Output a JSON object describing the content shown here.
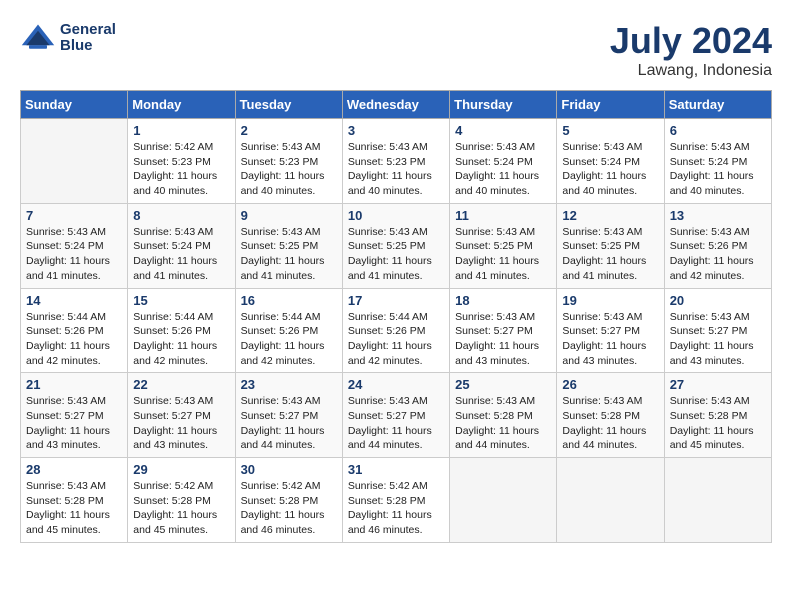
{
  "header": {
    "logo_line1": "General",
    "logo_line2": "Blue",
    "month_year": "July 2024",
    "location": "Lawang, Indonesia"
  },
  "days_of_week": [
    "Sunday",
    "Monday",
    "Tuesday",
    "Wednesday",
    "Thursday",
    "Friday",
    "Saturday"
  ],
  "weeks": [
    [
      {
        "day": "",
        "info": ""
      },
      {
        "day": "1",
        "info": "Sunrise: 5:42 AM\nSunset: 5:23 PM\nDaylight: 11 hours\nand 40 minutes."
      },
      {
        "day": "2",
        "info": "Sunrise: 5:43 AM\nSunset: 5:23 PM\nDaylight: 11 hours\nand 40 minutes."
      },
      {
        "day": "3",
        "info": "Sunrise: 5:43 AM\nSunset: 5:23 PM\nDaylight: 11 hours\nand 40 minutes."
      },
      {
        "day": "4",
        "info": "Sunrise: 5:43 AM\nSunset: 5:24 PM\nDaylight: 11 hours\nand 40 minutes."
      },
      {
        "day": "5",
        "info": "Sunrise: 5:43 AM\nSunset: 5:24 PM\nDaylight: 11 hours\nand 40 minutes."
      },
      {
        "day": "6",
        "info": "Sunrise: 5:43 AM\nSunset: 5:24 PM\nDaylight: 11 hours\nand 40 minutes."
      }
    ],
    [
      {
        "day": "7",
        "info": "Sunrise: 5:43 AM\nSunset: 5:24 PM\nDaylight: 11 hours\nand 41 minutes."
      },
      {
        "day": "8",
        "info": "Sunrise: 5:43 AM\nSunset: 5:24 PM\nDaylight: 11 hours\nand 41 minutes."
      },
      {
        "day": "9",
        "info": "Sunrise: 5:43 AM\nSunset: 5:25 PM\nDaylight: 11 hours\nand 41 minutes."
      },
      {
        "day": "10",
        "info": "Sunrise: 5:43 AM\nSunset: 5:25 PM\nDaylight: 11 hours\nand 41 minutes."
      },
      {
        "day": "11",
        "info": "Sunrise: 5:43 AM\nSunset: 5:25 PM\nDaylight: 11 hours\nand 41 minutes."
      },
      {
        "day": "12",
        "info": "Sunrise: 5:43 AM\nSunset: 5:25 PM\nDaylight: 11 hours\nand 41 minutes."
      },
      {
        "day": "13",
        "info": "Sunrise: 5:43 AM\nSunset: 5:26 PM\nDaylight: 11 hours\nand 42 minutes."
      }
    ],
    [
      {
        "day": "14",
        "info": "Sunrise: 5:44 AM\nSunset: 5:26 PM\nDaylight: 11 hours\nand 42 minutes."
      },
      {
        "day": "15",
        "info": "Sunrise: 5:44 AM\nSunset: 5:26 PM\nDaylight: 11 hours\nand 42 minutes."
      },
      {
        "day": "16",
        "info": "Sunrise: 5:44 AM\nSunset: 5:26 PM\nDaylight: 11 hours\nand 42 minutes."
      },
      {
        "day": "17",
        "info": "Sunrise: 5:44 AM\nSunset: 5:26 PM\nDaylight: 11 hours\nand 42 minutes."
      },
      {
        "day": "18",
        "info": "Sunrise: 5:43 AM\nSunset: 5:27 PM\nDaylight: 11 hours\nand 43 minutes."
      },
      {
        "day": "19",
        "info": "Sunrise: 5:43 AM\nSunset: 5:27 PM\nDaylight: 11 hours\nand 43 minutes."
      },
      {
        "day": "20",
        "info": "Sunrise: 5:43 AM\nSunset: 5:27 PM\nDaylight: 11 hours\nand 43 minutes."
      }
    ],
    [
      {
        "day": "21",
        "info": "Sunrise: 5:43 AM\nSunset: 5:27 PM\nDaylight: 11 hours\nand 43 minutes."
      },
      {
        "day": "22",
        "info": "Sunrise: 5:43 AM\nSunset: 5:27 PM\nDaylight: 11 hours\nand 43 minutes."
      },
      {
        "day": "23",
        "info": "Sunrise: 5:43 AM\nSunset: 5:27 PM\nDaylight: 11 hours\nand 44 minutes."
      },
      {
        "day": "24",
        "info": "Sunrise: 5:43 AM\nSunset: 5:27 PM\nDaylight: 11 hours\nand 44 minutes."
      },
      {
        "day": "25",
        "info": "Sunrise: 5:43 AM\nSunset: 5:28 PM\nDaylight: 11 hours\nand 44 minutes."
      },
      {
        "day": "26",
        "info": "Sunrise: 5:43 AM\nSunset: 5:28 PM\nDaylight: 11 hours\nand 44 minutes."
      },
      {
        "day": "27",
        "info": "Sunrise: 5:43 AM\nSunset: 5:28 PM\nDaylight: 11 hours\nand 45 minutes."
      }
    ],
    [
      {
        "day": "28",
        "info": "Sunrise: 5:43 AM\nSunset: 5:28 PM\nDaylight: 11 hours\nand 45 minutes."
      },
      {
        "day": "29",
        "info": "Sunrise: 5:42 AM\nSunset: 5:28 PM\nDaylight: 11 hours\nand 45 minutes."
      },
      {
        "day": "30",
        "info": "Sunrise: 5:42 AM\nSunset: 5:28 PM\nDaylight: 11 hours\nand 46 minutes."
      },
      {
        "day": "31",
        "info": "Sunrise: 5:42 AM\nSunset: 5:28 PM\nDaylight: 11 hours\nand 46 minutes."
      },
      {
        "day": "",
        "info": ""
      },
      {
        "day": "",
        "info": ""
      },
      {
        "day": "",
        "info": ""
      }
    ]
  ]
}
